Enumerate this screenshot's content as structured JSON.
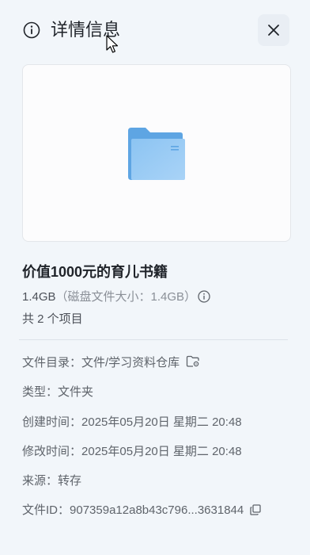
{
  "header": {
    "title": "详情信息",
    "info_icon": "info-circle-icon",
    "close_icon": "close-icon"
  },
  "preview": {
    "icon": "folder-icon"
  },
  "file": {
    "name": "价值1000元的育儿书籍",
    "size": "1.4GB",
    "disk_size_text": "（磁盘文件大小：1.4GB）",
    "item_count": "共 2 个项目"
  },
  "details": {
    "directory_label": "文件目录：",
    "directory_value": "文件/学习资料仓库",
    "type_label": "类型：",
    "type_value": "文件夹",
    "created_label": "创建时间：",
    "created_value": "2025年05月20日 星期二 20:48",
    "modified_label": "修改时间：",
    "modified_value": "2025年05月20日 星期二 20:48",
    "source_label": "来源：",
    "source_value": "转存",
    "file_id_label": "文件ID：",
    "file_id_value": "907359a12a8b43c796...3631844"
  },
  "colors": {
    "background": "#f2f6fa",
    "folder_blue": "#6aaee8",
    "text_primary": "#1f2329",
    "text_secondary": "#5f646b"
  }
}
